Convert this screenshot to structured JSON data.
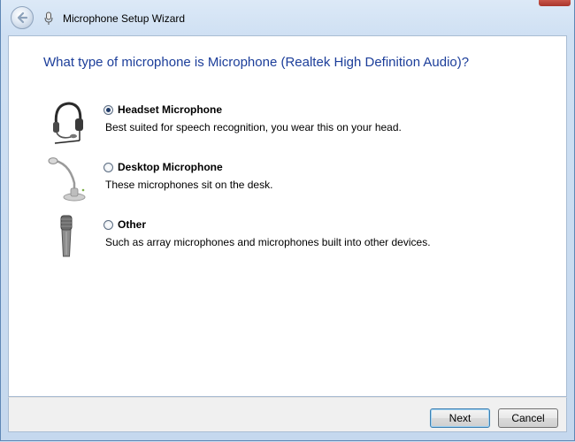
{
  "window": {
    "title": "Microphone Setup Wizard"
  },
  "page": {
    "heading": "What type of microphone is Microphone (Realtek High Definition Audio)?"
  },
  "options": [
    {
      "label": "Headset Microphone",
      "description": "Best suited for speech recognition, you wear this on your head.",
      "selected": true,
      "icon": "headset-microphone-icon"
    },
    {
      "label": "Desktop Microphone",
      "description": "These microphones sit on the desk.",
      "selected": false,
      "icon": "desktop-microphone-icon"
    },
    {
      "label": "Other",
      "description": "Such as array microphones and microphones built into other devices.",
      "selected": false,
      "icon": "handheld-microphone-icon"
    }
  ],
  "footer": {
    "next_label": "Next",
    "cancel_label": "Cancel"
  },
  "colors": {
    "heading": "#1c3e9a",
    "frame": "#c9dcf0",
    "content_bg": "#ffffff",
    "footer_bg": "#f0f0f0"
  }
}
